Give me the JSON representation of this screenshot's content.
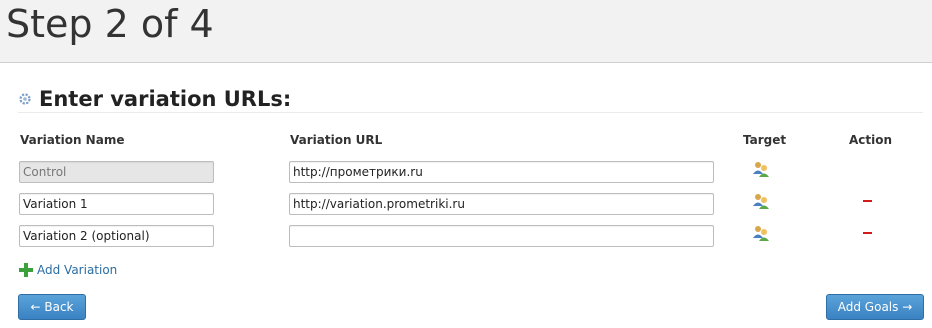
{
  "header": {
    "title": "Step 2 of 4"
  },
  "section": {
    "title": "Enter variation URLs:"
  },
  "columns": {
    "name": "Variation Name",
    "url": "Variation URL",
    "target": "Target",
    "action": "Action"
  },
  "rows": [
    {
      "name": "Control",
      "url": "http://прометрики.ru",
      "name_disabled": true,
      "removable": false
    },
    {
      "name": "Variation 1",
      "url": "http://variation.prometriki.ru",
      "name_disabled": false,
      "removable": true
    },
    {
      "name": "Variation 2 (optional)",
      "url": "",
      "name_disabled": false,
      "removable": true
    }
  ],
  "add_variation": {
    "label": "Add Variation"
  },
  "buttons": {
    "back": "← Back",
    "next": "Add Goals →"
  },
  "colors": {
    "accent": "#3a82c2",
    "link": "#2a6ca3",
    "remove": "#d21b1b",
    "plus": "#3ca03c"
  },
  "icons": {
    "section": "gear-icon",
    "target": "users-icon",
    "remove": "minus-icon",
    "add": "plus-icon"
  }
}
